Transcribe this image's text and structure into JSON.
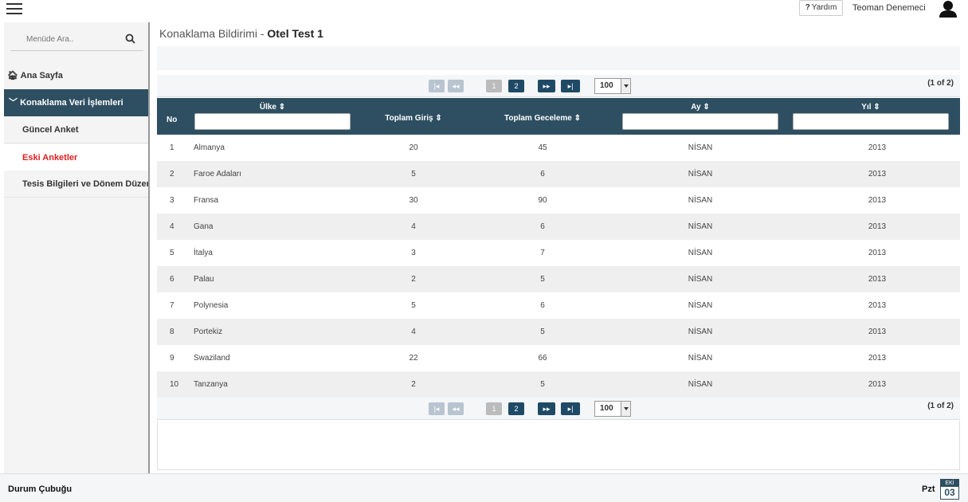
{
  "header": {
    "help_label": "Yardım",
    "help_glyph": "?",
    "username": "Teoman Denemeci"
  },
  "sidebar": {
    "search_placeholder": "Menüde Ara..",
    "home": "Ana Sayfa",
    "group": "Konaklama Veri İşlemleri",
    "items": [
      {
        "label": "Güncel Anket"
      },
      {
        "label": "Eski Anketler"
      },
      {
        "label": "Tesis Bilgileri ve Dönem Düzenleme"
      }
    ]
  },
  "page": {
    "title_prefix": "Konaklama Bildirimi - ",
    "title_bold": "Otel Test 1"
  },
  "pager": {
    "pages": [
      "1",
      "2"
    ],
    "current_page": "2",
    "rows_per_page": "100",
    "count": "(1 of 2)",
    "first_glyph": "|◂",
    "prev_glyph": "◂◂",
    "next_glyph": "▸▸",
    "last_glyph": "▸|"
  },
  "table": {
    "headers": {
      "no": "No",
      "ulke": "Ülke ⇕",
      "giris": "Toplam Giriş ⇕",
      "geceleme": "Toplam Geceleme ⇕",
      "ay": "Ay ⇕",
      "yil": "Yıl ⇕"
    },
    "rows": [
      {
        "no": "1",
        "ulke": "Almanya",
        "giris": "20",
        "geceleme": "45",
        "ay": "NİSAN",
        "yil": "2013"
      },
      {
        "no": "2",
        "ulke": "Faroe Adaları",
        "giris": "5",
        "geceleme": "6",
        "ay": "NİSAN",
        "yil": "2013"
      },
      {
        "no": "3",
        "ulke": "Fransa",
        "giris": "30",
        "geceleme": "90",
        "ay": "NİSAN",
        "yil": "2013"
      },
      {
        "no": "4",
        "ulke": "Gana",
        "giris": "4",
        "geceleme": "6",
        "ay": "NİSAN",
        "yil": "2013"
      },
      {
        "no": "5",
        "ulke": "İtalya",
        "giris": "3",
        "geceleme": "7",
        "ay": "NİSAN",
        "yil": "2013"
      },
      {
        "no": "6",
        "ulke": "Palau",
        "giris": "2",
        "geceleme": "5",
        "ay": "NİSAN",
        "yil": "2013"
      },
      {
        "no": "7",
        "ulke": "Polynesia",
        "giris": "5",
        "geceleme": "6",
        "ay": "NİSAN",
        "yil": "2013"
      },
      {
        "no": "8",
        "ulke": "Portekiz",
        "giris": "4",
        "geceleme": "5",
        "ay": "NİSAN",
        "yil": "2013"
      },
      {
        "no": "9",
        "ulke": "Swaziland",
        "giris": "22",
        "geceleme": "66",
        "ay": "NİSAN",
        "yil": "2013"
      },
      {
        "no": "10",
        "ulke": "Tanzanya",
        "giris": "2",
        "geceleme": "5",
        "ay": "NİSAN",
        "yil": "2013"
      }
    ]
  },
  "statusbar": {
    "label": "Durum Çubuğu",
    "day": "Pzt",
    "cal_month": "EKİ",
    "cal_day": "03"
  },
  "colors": {
    "accent": "#2e4f61",
    "active_item": "#e02020"
  }
}
